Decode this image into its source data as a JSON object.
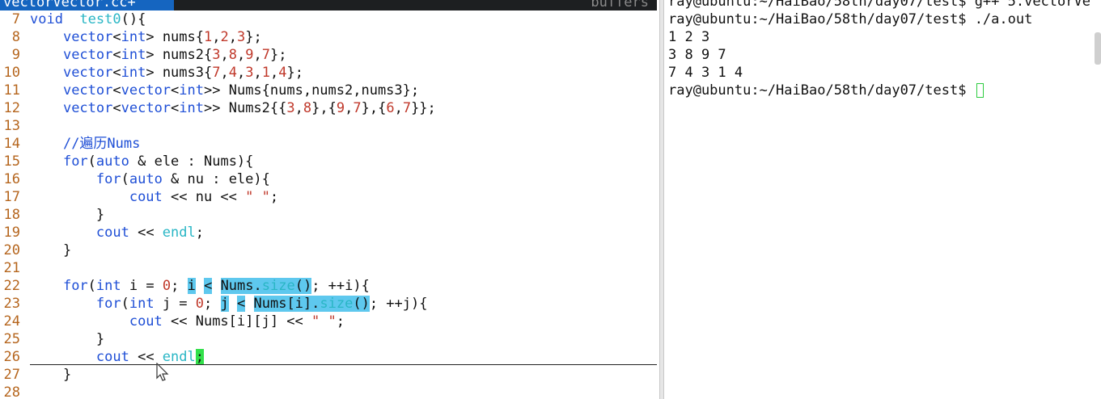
{
  "editor": {
    "tab_active": "vectorVector.cc+",
    "buffers_label": "buffers",
    "lines": [
      {
        "n": "7",
        "tokens": [
          [
            "kw",
            "void"
          ],
          [
            "",
            "  "
          ],
          [
            "fn",
            "test0"
          ],
          [
            "",
            "(){"
          ]
        ]
      },
      {
        "n": "8",
        "tokens": [
          [
            "",
            "    "
          ],
          [
            "kw",
            "vector"
          ],
          [
            "",
            "<"
          ],
          [
            "kw",
            "int"
          ],
          [
            "",
            "> nums{"
          ],
          [
            "num",
            "1"
          ],
          [
            "",
            ","
          ],
          [
            "num",
            "2"
          ],
          [
            "",
            ","
          ],
          [
            "num",
            "3"
          ],
          [
            "",
            "};"
          ]
        ]
      },
      {
        "n": "9",
        "tokens": [
          [
            "",
            "    "
          ],
          [
            "kw",
            "vector"
          ],
          [
            "",
            "<"
          ],
          [
            "kw",
            "int"
          ],
          [
            "",
            "> nums2{"
          ],
          [
            "num",
            "3"
          ],
          [
            "",
            ","
          ],
          [
            "num",
            "8"
          ],
          [
            "",
            ","
          ],
          [
            "num",
            "9"
          ],
          [
            "",
            ","
          ],
          [
            "num",
            "7"
          ],
          [
            "",
            "};"
          ]
        ]
      },
      {
        "n": "10",
        "tokens": [
          [
            "",
            "    "
          ],
          [
            "kw",
            "vector"
          ],
          [
            "",
            "<"
          ],
          [
            "kw",
            "int"
          ],
          [
            "",
            "> nums3{"
          ],
          [
            "num",
            "7"
          ],
          [
            "",
            ","
          ],
          [
            "num",
            "4"
          ],
          [
            "",
            ","
          ],
          [
            "num",
            "3"
          ],
          [
            "",
            ","
          ],
          [
            "num",
            "1"
          ],
          [
            "",
            ","
          ],
          [
            "num",
            "4"
          ],
          [
            "",
            "};"
          ]
        ]
      },
      {
        "n": "11",
        "tokens": [
          [
            "",
            "    "
          ],
          [
            "kw",
            "vector"
          ],
          [
            "",
            "<"
          ],
          [
            "kw",
            "vector"
          ],
          [
            "",
            "<"
          ],
          [
            "kw",
            "int"
          ],
          [
            "",
            ">> Nums{nums,nums2,nums3};"
          ]
        ]
      },
      {
        "n": "12",
        "tokens": [
          [
            "",
            "    "
          ],
          [
            "kw",
            "vector"
          ],
          [
            "",
            "<"
          ],
          [
            "kw",
            "vector"
          ],
          [
            "",
            "<"
          ],
          [
            "kw",
            "int"
          ],
          [
            "",
            ">> Nums2{{"
          ],
          [
            "num",
            "3"
          ],
          [
            "",
            ","
          ],
          [
            "num",
            "8"
          ],
          [
            "",
            "},{"
          ],
          [
            "num",
            "9"
          ],
          [
            "",
            ","
          ],
          [
            "num",
            "7"
          ],
          [
            "",
            "},{"
          ],
          [
            "num",
            "6"
          ],
          [
            "",
            ","
          ],
          [
            "num",
            "7"
          ],
          [
            "",
            "}};"
          ]
        ]
      },
      {
        "n": "13",
        "tokens": []
      },
      {
        "n": "14",
        "tokens": [
          [
            "",
            "    "
          ],
          [
            "cmt",
            "//遍历Nums"
          ]
        ]
      },
      {
        "n": "15",
        "tokens": [
          [
            "",
            "    "
          ],
          [
            "kw",
            "for"
          ],
          [
            "",
            "("
          ],
          [
            "kw",
            "auto"
          ],
          [
            "",
            " & ele : Nums){"
          ]
        ]
      },
      {
        "n": "16",
        "tokens": [
          [
            "",
            "        "
          ],
          [
            "kw",
            "for"
          ],
          [
            "",
            "("
          ],
          [
            "kw",
            "auto"
          ],
          [
            "",
            " & nu : ele){"
          ]
        ]
      },
      {
        "n": "17",
        "tokens": [
          [
            "",
            "            "
          ],
          [
            "kw",
            "cout"
          ],
          [
            "",
            " << nu << "
          ],
          [
            "str",
            "\" \""
          ],
          [
            "",
            ";"
          ]
        ]
      },
      {
        "n": "18",
        "tokens": [
          [
            "",
            "        }"
          ]
        ]
      },
      {
        "n": "19",
        "tokens": [
          [
            "",
            "        "
          ],
          [
            "kw",
            "cout"
          ],
          [
            "",
            " << "
          ],
          [
            "fn",
            "endl"
          ],
          [
            "",
            ";"
          ]
        ]
      },
      {
        "n": "20",
        "tokens": [
          [
            "",
            "    }"
          ]
        ]
      },
      {
        "n": "21",
        "tokens": []
      },
      {
        "n": "22",
        "tokens": [
          [
            "",
            "    "
          ],
          [
            "kw",
            "for"
          ],
          [
            "",
            "("
          ],
          [
            "kw",
            "int"
          ],
          [
            "",
            " i = "
          ],
          [
            "num",
            "0"
          ],
          [
            "",
            "; "
          ],
          [
            "hl",
            "i"
          ],
          [
            "",
            " "
          ],
          [
            "hl",
            "<"
          ],
          [
            "",
            " "
          ],
          [
            "hl",
            "Nums."
          ],
          [
            "hl fn",
            "size"
          ],
          [
            "hl",
            "()"
          ],
          [
            "",
            "; ++i){"
          ]
        ]
      },
      {
        "n": "23",
        "tokens": [
          [
            "",
            "        "
          ],
          [
            "kw",
            "for"
          ],
          [
            "",
            "("
          ],
          [
            "kw",
            "int"
          ],
          [
            "",
            " j = "
          ],
          [
            "num",
            "0"
          ],
          [
            "",
            "; "
          ],
          [
            "hl",
            "j"
          ],
          [
            "",
            " "
          ],
          [
            "hl",
            "<"
          ],
          [
            "",
            " "
          ],
          [
            "hl",
            "Nums[i]."
          ],
          [
            "hl fn",
            "size"
          ],
          [
            "hl",
            "()"
          ],
          [
            "",
            "; ++j){"
          ]
        ]
      },
      {
        "n": "24",
        "tokens": [
          [
            "",
            "            "
          ],
          [
            "kw",
            "cout"
          ],
          [
            "",
            " << Nums[i][j] << "
          ],
          [
            "str",
            "\" \""
          ],
          [
            "",
            ";"
          ]
        ]
      },
      {
        "n": "25",
        "tokens": [
          [
            "",
            "        }"
          ]
        ]
      },
      {
        "n": "26",
        "tokens": [
          [
            "",
            "        "
          ],
          [
            "kw",
            "cout"
          ],
          [
            "",
            " << "
          ],
          [
            "fn",
            "endl"
          ],
          [
            "cur",
            ";"
          ]
        ]
      },
      {
        "n": "27",
        "tokens": [
          [
            "",
            "    }"
          ]
        ]
      },
      {
        "n": "28",
        "tokens": []
      }
    ]
  },
  "terminal": {
    "lines": [
      "ray@ubuntu:~/HaiBao/58th/day07/test$ g++ 5.vectorVe",
      "ray@ubuntu:~/HaiBao/58th/day07/test$ ./a.out",
      "1 2 3",
      "3 8 9 7",
      "7 4 3 1 4"
    ],
    "prompt": "ray@ubuntu:~/HaiBao/58th/day07/test$ "
  },
  "colors": {
    "keyword": "#1f4fd6",
    "number": "#c0392b",
    "function": "#29b6c5",
    "search_highlight": "#5ec8ee",
    "cursor": "#32e04a",
    "line_number": "#b5651d",
    "tab_active": "#1565c0"
  }
}
